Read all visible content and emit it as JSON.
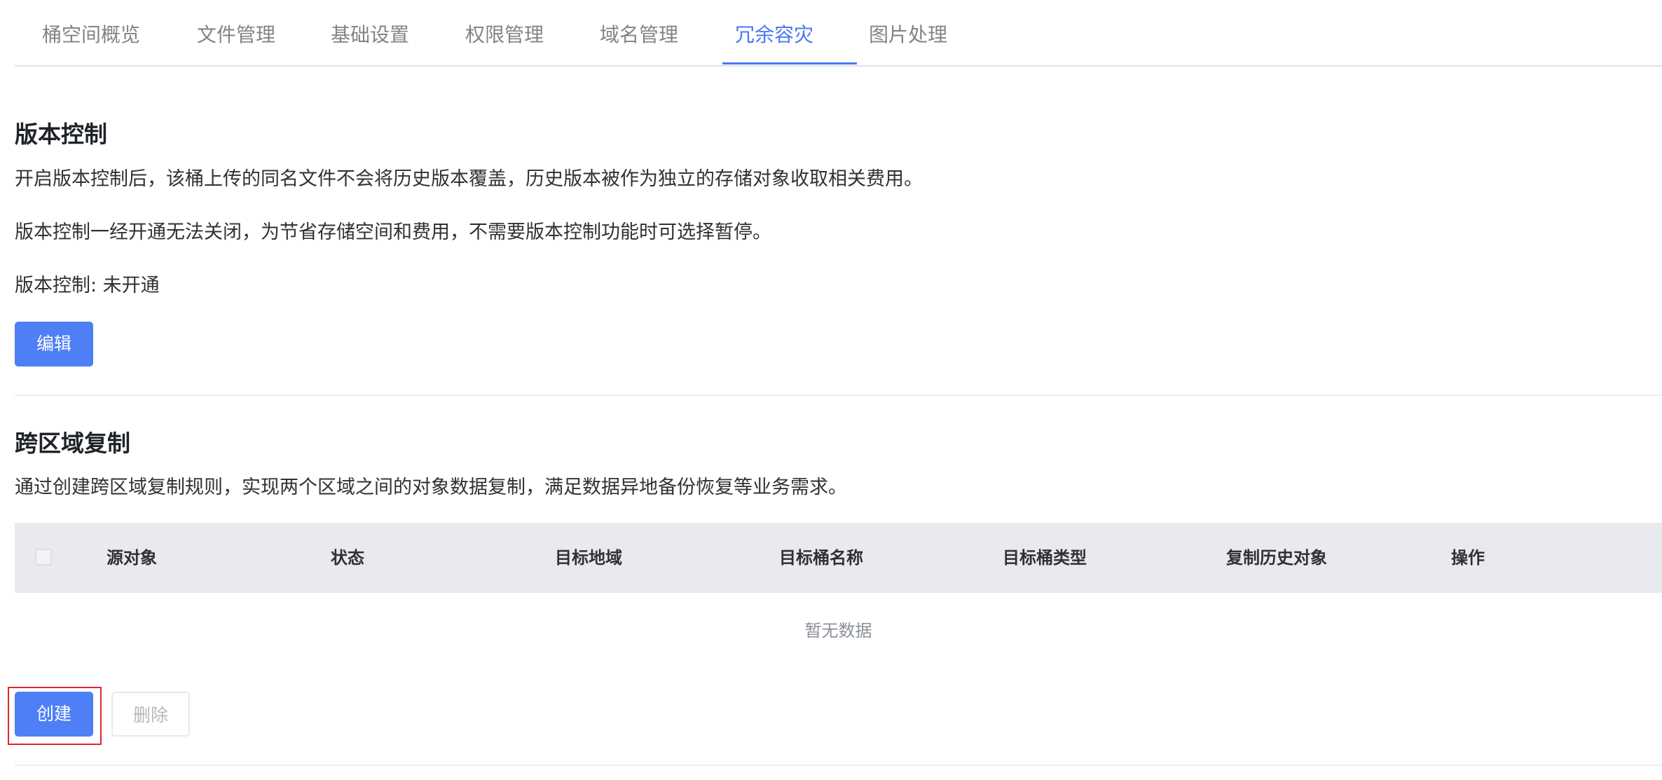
{
  "tabs": [
    {
      "label": "桶空间概览",
      "active": false
    },
    {
      "label": "文件管理",
      "active": false
    },
    {
      "label": "基础设置",
      "active": false
    },
    {
      "label": "权限管理",
      "active": false
    },
    {
      "label": "域名管理",
      "active": false
    },
    {
      "label": "冗余容灾",
      "active": true
    },
    {
      "label": "图片处理",
      "active": false
    }
  ],
  "versioning": {
    "title": "版本控制",
    "desc1": "开启版本控制后，该桶上传的同名文件不会将历史版本覆盖，历史版本被作为独立的存储对象收取相关费用。",
    "desc2": "版本控制一经开通无法关闭，为节省存储空间和费用，不需要版本控制功能时可选择暂停。",
    "status": "版本控制: 未开通",
    "edit_label": "编辑"
  },
  "replication": {
    "title": "跨区域复制",
    "desc": "通过创建跨区域复制规则，实现两个区域之间的对象数据复制，满足数据异地备份恢复等业务需求。",
    "columns": [
      "源对象",
      "状态",
      "目标地域",
      "目标桶名称",
      "目标桶类型",
      "复制历史对象",
      "操作"
    ],
    "rows": [],
    "empty_text": "暂无数据",
    "create_label": "创建",
    "delete_label": "删除"
  },
  "colors": {
    "accent": "#4a78f0",
    "primary_button": "#4f7ff6",
    "highlight_border": "#e0262d"
  }
}
